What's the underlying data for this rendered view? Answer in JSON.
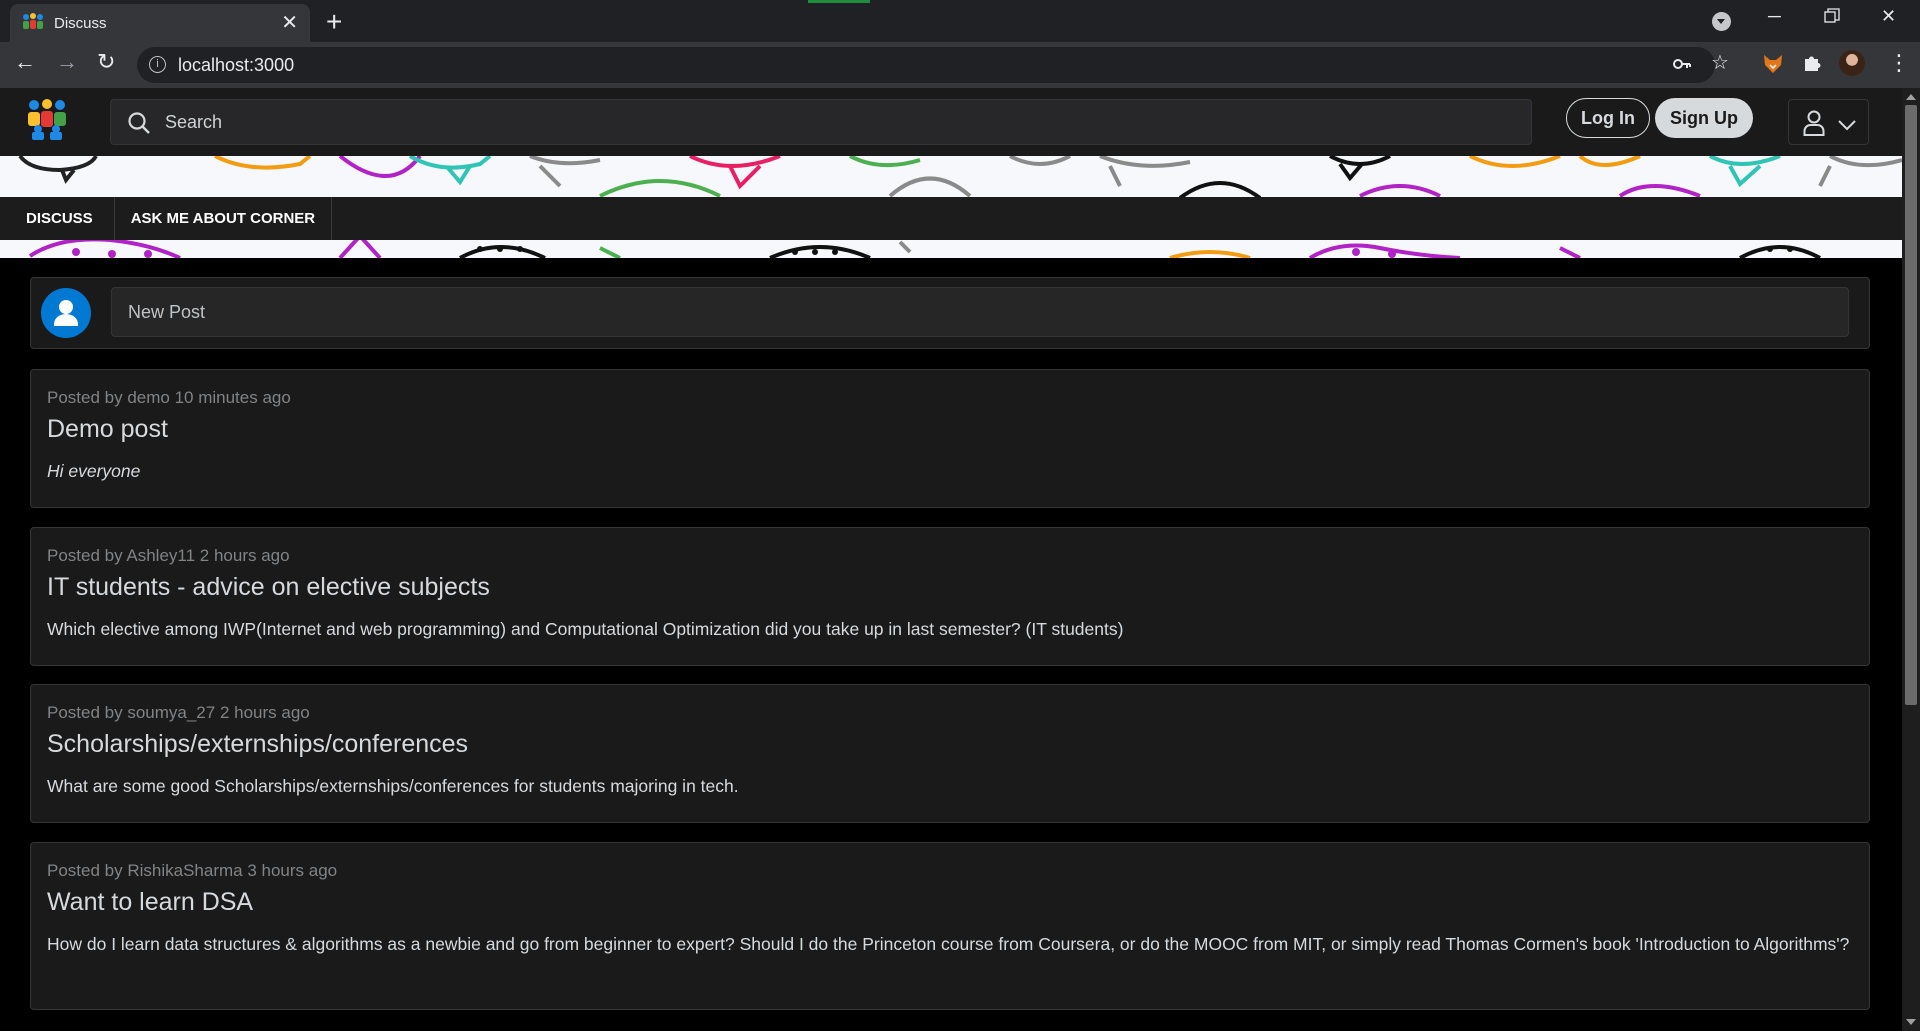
{
  "browser": {
    "tab_title": "Discuss",
    "url": "localhost:3000"
  },
  "header": {
    "search_placeholder": "Search",
    "login_label": "Log In",
    "signup_label": "Sign Up"
  },
  "nav": {
    "tabs": [
      "DISCUSS",
      "ASK ME ABOUT CORNER"
    ]
  },
  "new_post": {
    "placeholder": "New Post"
  },
  "posts": [
    {
      "meta": "Posted by demo 10 minutes ago",
      "title": "Demo post",
      "body": "Hi everyone"
    },
    {
      "meta": "Posted by Ashley11 2 hours ago",
      "title": "IT students - advice on elective subjects",
      "body": "Which elective among IWP(Internet and web programming) and Computational Optimization did you take up in last semester? (IT students)"
    },
    {
      "meta": "Posted by soumya_27 2 hours ago",
      "title": "Scholarships/externships/conferences",
      "body": "What are some good Scholarships/externships/conferences for students majoring in tech."
    },
    {
      "meta": "Posted by RishikaSharma 3 hours ago",
      "title": "Want to learn DSA",
      "body": "How do I learn data structures & algorithms as a newbie and go from beginner to expert? Should I do the Princeton course from Coursera, or do the MOOC from MIT, or simply read Thomas Cormen's book 'Introduction to Algorithms'?"
    }
  ],
  "colors": {
    "page_bg": "#000000",
    "card_bg": "#1a1a1b",
    "border": "#343536",
    "text": "#d7dadc",
    "meta": "#818384",
    "avatar": "#0079d3"
  },
  "icons": [
    "app-logo-icon",
    "search-icon",
    "user-icon",
    "chevron-down-icon",
    "close-icon",
    "back-icon",
    "forward-icon",
    "reload-icon",
    "info-icon",
    "key-icon",
    "star-icon",
    "fox-extension-icon",
    "puzzle-icon",
    "avatar-icon"
  ]
}
